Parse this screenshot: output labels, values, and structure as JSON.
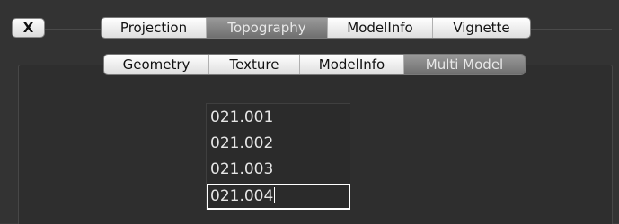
{
  "close_button": {
    "label": "X"
  },
  "main_tabs": [
    {
      "label": "Projection",
      "selected": false
    },
    {
      "label": "Topography",
      "selected": true
    },
    {
      "label": "ModelInfo",
      "selected": false
    },
    {
      "label": "Vignette",
      "selected": false
    }
  ],
  "sub_tabs": [
    {
      "label": "Geometry",
      "selected": false
    },
    {
      "label": "Texture",
      "selected": false
    },
    {
      "label": "ModelInfo",
      "selected": false
    },
    {
      "label": "Multi Model",
      "selected": true
    }
  ],
  "model_list": {
    "items": [
      "021.001",
      "021.002",
      "021.003",
      "021.004"
    ],
    "editing_index": 3
  },
  "colors": {
    "background": "#333333",
    "selected_tab": "#808080",
    "text_light": "#e6e6e6"
  }
}
